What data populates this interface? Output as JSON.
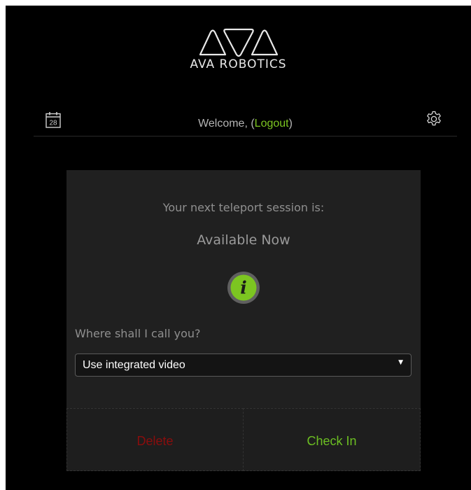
{
  "logo": {
    "text": "AVA ROBOTICS"
  },
  "header": {
    "calendar_day": "28",
    "welcome_text": "Welcome, (",
    "logout_label": "Logout",
    "welcome_close": ")",
    "icons": {
      "left": "calendar-icon",
      "right": "gear-icon"
    }
  },
  "session": {
    "next_label": "Your next teleport session is:",
    "status": "Available Now",
    "info_glyph": "i"
  },
  "call": {
    "label": "Where shall I call you?",
    "selected_option": "Use integrated video",
    "caret": "▼"
  },
  "actions": {
    "delete_label": "Delete",
    "checkin_label": "Check In"
  },
  "colors": {
    "accent_green": "#7cc521",
    "delete_red": "#8a0d0d",
    "card_bg": "#202020",
    "page_bg": "#000000"
  }
}
